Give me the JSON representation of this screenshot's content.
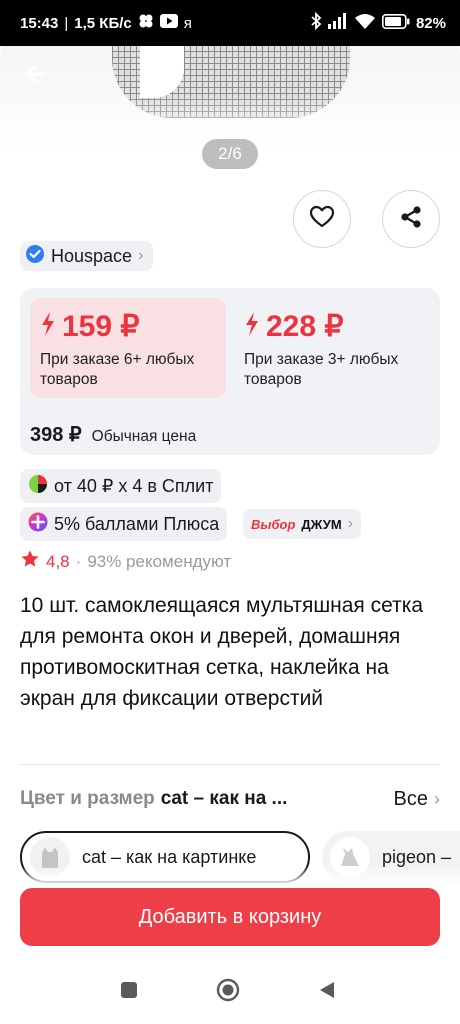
{
  "status_bar": {
    "time": "15:43",
    "speed": "1,5 КБ/с",
    "carrier_glyph": "я",
    "battery": "82",
    "icons": [
      "clover-icon",
      "youtube-icon",
      "bluetooth-icon",
      "signal-icon",
      "wifi-icon",
      "battery-icon"
    ]
  },
  "gallery": {
    "indicator": "2/6",
    "back_icon": "arrow-left-icon"
  },
  "actions": {
    "favorite_icon": "heart-icon",
    "share_icon": "share-icon"
  },
  "seller": {
    "name": "Houspace",
    "badge_icon": "verified-check-icon"
  },
  "prices": {
    "tier1": {
      "price": "159 ₽",
      "note": "При заказе 6+ любых товаров"
    },
    "tier2": {
      "price": "228 ₽",
      "note": "При заказе 3+ любых товаров"
    },
    "regular_price": "398 ₽",
    "regular_label": "Обычная цена",
    "accent_color": "#ee3340",
    "highlight_bg": "#f9e0e2"
  },
  "promos": {
    "split": "от 40 ₽ x 4 в Сплит",
    "plus": "5% баллами Плюса",
    "jum_vybor": "Выбор",
    "jum_name": "ДЖУМ"
  },
  "rating": {
    "score": "4,8",
    "separator": "·",
    "recommend": "93% рекомендуют"
  },
  "product": {
    "title": "10 шт. самоклеящаяся мультяшная сетка для ремонта окон и дверей, домашняя противомоскитная сетка, наклейка на экран для фиксации отверстий"
  },
  "variants": {
    "label": "Цвет и размер",
    "selected_short": "cat – как на ...",
    "all_label": "Все",
    "options": [
      {
        "label": "cat – как на картинке",
        "selected": true
      },
      {
        "label": "pigeon –",
        "selected": false
      }
    ]
  },
  "cart": {
    "label": "Добавить в корзину",
    "color": "#ee3f48"
  },
  "nav": {
    "icons": [
      "recent-apps-icon",
      "home-icon",
      "back-icon"
    ]
  }
}
